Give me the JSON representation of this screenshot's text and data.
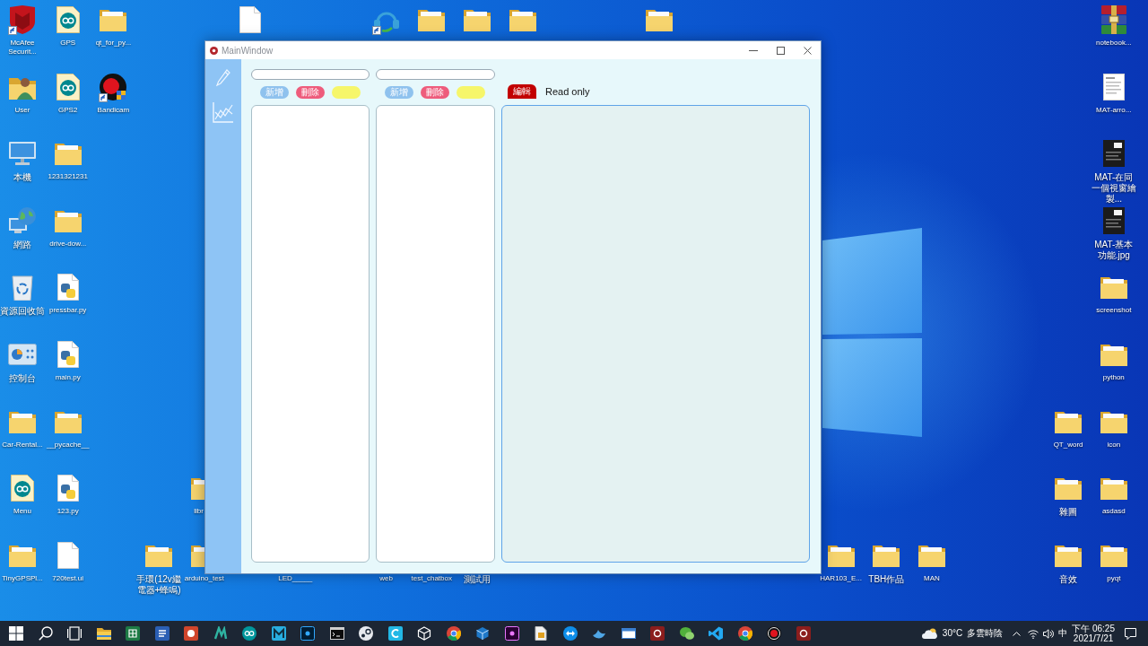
{
  "desktop": {
    "icons": [
      {
        "label": "McAfee Securit...",
        "kind": "shield",
        "shortcut": true
      },
      {
        "label": "GPS",
        "kind": "sketch",
        "shortcut": false
      },
      {
        "label": "qt_for_py...",
        "kind": "folder",
        "shortcut": false
      },
      {
        "kind": "file",
        "shortcut": false
      },
      {
        "kind": "headset",
        "shortcut": true
      },
      {
        "kind": "folder",
        "shortcut": false
      },
      {
        "kind": "folder",
        "shortcut": false
      },
      {
        "kind": "folder",
        "shortcut": false
      },
      {
        "kind": "folder",
        "shortcut": false
      },
      {
        "label": "notebook...",
        "kind": "archive",
        "shortcut": false
      },
      {
        "label": "User",
        "kind": "user-folder",
        "shortcut": false
      },
      {
        "label": "GPS2",
        "kind": "sketch",
        "shortcut": false
      },
      {
        "label": "Bandicam",
        "kind": "recorder",
        "shortcut": true
      },
      {
        "label": "MAT-arro...",
        "kind": "light-image",
        "shortcut": false
      },
      {
        "label": "本機",
        "kind": "computer",
        "shortcut": false
      },
      {
        "label": "1231321231",
        "kind": "folder",
        "shortcut": false
      },
      {
        "label": "MAT-在同一個視窗繪製...",
        "kind": "dark-image",
        "shortcut": false
      },
      {
        "label": "網路",
        "kind": "network",
        "shortcut": false
      },
      {
        "label": "drive-dow...",
        "kind": "folder",
        "shortcut": false
      },
      {
        "label": "MAT-基本功能.jpg",
        "kind": "dark-image",
        "shortcut": false
      },
      {
        "label": "資源回收筒",
        "kind": "recycle-bin",
        "shortcut": false
      },
      {
        "label": "pressbar.py",
        "kind": "python",
        "shortcut": false
      },
      {
        "label": "screenshot",
        "kind": "folder",
        "shortcut": false
      },
      {
        "label": "控制台",
        "kind": "control-panel",
        "shortcut": false
      },
      {
        "label": "main.py",
        "kind": "python",
        "shortcut": false
      },
      {
        "label": "python",
        "kind": "folder",
        "shortcut": false
      },
      {
        "label": "Car-Rental...",
        "kind": "folder",
        "shortcut": false
      },
      {
        "label": "__pycache__",
        "kind": "folder",
        "shortcut": false
      },
      {
        "label": "QT_word",
        "kind": "folder",
        "shortcut": false
      },
      {
        "label": "icon",
        "kind": "folder",
        "shortcut": false
      },
      {
        "label": "Menu",
        "kind": "sketch",
        "shortcut": false
      },
      {
        "label": "123.py",
        "kind": "python",
        "shortcut": false
      },
      {
        "label": "libr",
        "kind": "folder",
        "shortcut": false
      },
      {
        "label": "雜圖",
        "kind": "folder",
        "shortcut": false
      },
      {
        "label": "asdasd",
        "kind": "folder",
        "shortcut": false
      },
      {
        "label": "TinyGPSPl...",
        "kind": "folder",
        "shortcut": false
      },
      {
        "label": "720test.ui",
        "kind": "file",
        "shortcut": false
      },
      {
        "label": "手環(12v繼電器+蜂鳴)",
        "kind": "folder",
        "shortcut": false
      },
      {
        "label": "arduino_test",
        "kind": "folder",
        "shortcut": false
      },
      {
        "label": "LED_____"
      },
      {
        "label": "web"
      },
      {
        "label": "test_chatbox"
      },
      {
        "label": "測試用"
      },
      {
        "label": "HAR103_E...",
        "kind": "folder",
        "shortcut": false
      },
      {
        "label": "TBH作品",
        "kind": "folder",
        "shortcut": false
      },
      {
        "label": "MAN",
        "kind": "folder",
        "shortcut": false
      },
      {
        "label": "音效",
        "kind": "folder",
        "shortcut": false
      },
      {
        "label": "pyqt",
        "kind": "folder",
        "shortcut": false
      }
    ]
  },
  "window": {
    "title": "MainWindow",
    "lists": [
      {
        "buttons": [
          {
            "kind": "add",
            "label": "新增"
          },
          {
            "kind": "delete",
            "label": "刪除"
          },
          {
            "kind": "blank"
          }
        ]
      },
      {
        "buttons": [
          {
            "kind": "add",
            "label": "新增"
          },
          {
            "kind": "delete",
            "label": "刪除"
          },
          {
            "kind": "blank"
          }
        ]
      }
    ],
    "editor": {
      "button": "編輯",
      "status": "Read only"
    }
  },
  "taskbar": {
    "weather": {
      "temperature": "30°C",
      "condition": "多雲時陰"
    },
    "input_method": "中",
    "time": "下午 06:25",
    "date": "2021/7/21"
  }
}
